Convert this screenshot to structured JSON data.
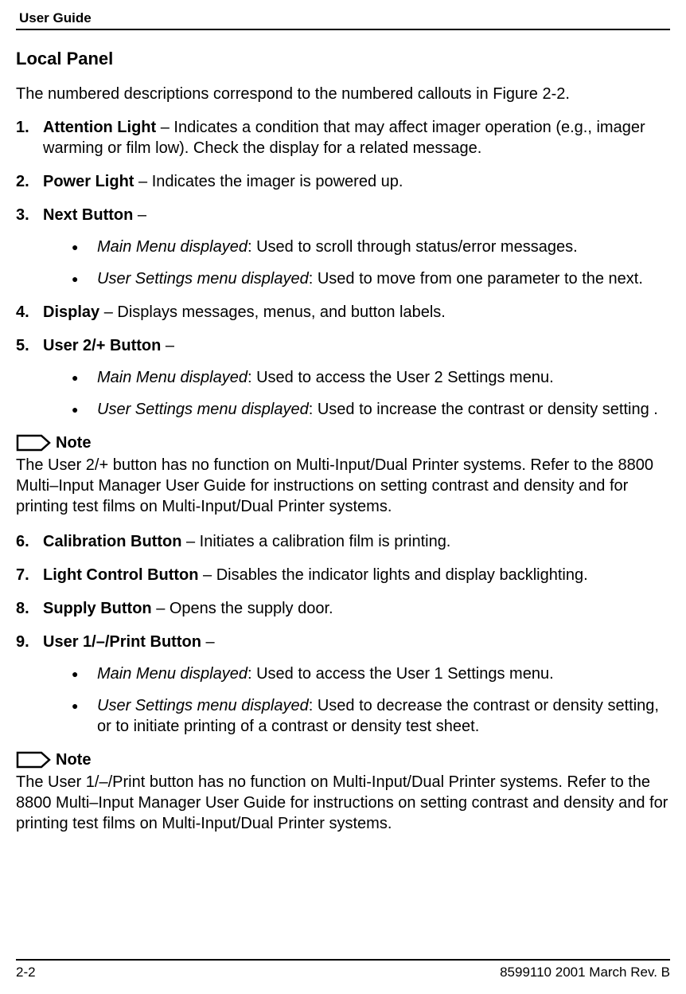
{
  "header": {
    "label": "User Guide"
  },
  "section": {
    "title": "Local Panel",
    "intro": "The numbered descriptions correspond to the numbered callouts in Figure 2-2."
  },
  "items": {
    "i1": {
      "num": "1.",
      "term": "Attention Light",
      "desc": " – Indicates a condition that may affect imager operation (e.g., imager warming or film low). Check the display for a related message."
    },
    "i2": {
      "num": "2.",
      "term": "Power Light",
      "desc": " – Indicates the imager is powered up."
    },
    "i3": {
      "num": "3.",
      "term": "Next Button",
      "desc": " –",
      "sub": {
        "a": {
          "em": "Main Menu displayed",
          "rest": ": Used to scroll through status/error messages."
        },
        "b": {
          "em": "User Settings menu displayed",
          "rest": ": Used to move from one parameter to the next."
        }
      }
    },
    "i4": {
      "num": "4.",
      "term": "Display",
      "desc": " – Displays messages, menus, and button labels."
    },
    "i5": {
      "num": "5.",
      "term": "User 2/+ Button",
      "desc": " –",
      "sub": {
        "a": {
          "em": "Main Menu displayed",
          "rest": ": Used to access the User 2 Settings menu."
        },
        "b": {
          "em": "User Settings menu displayed",
          "rest": ": Used to increase the contrast or density setting ."
        }
      }
    },
    "i6": {
      "num": "6.",
      "term": "Calibration Button",
      "desc": " – Initiates a calibration film is printing."
    },
    "i7": {
      "num": "7.",
      "term": "Light Control Button",
      "desc": " – Disables the indicator lights and display backlighting."
    },
    "i8": {
      "num": "8.",
      "term": "Supply Button",
      "desc": " – Opens the supply door."
    },
    "i9": {
      "num": "9.",
      "term": "User 1/–/Print Button",
      "desc": " –",
      "sub": {
        "a": {
          "em": "Main Menu displayed",
          "rest": ": Used to access the User 1 Settings menu."
        },
        "b": {
          "em": "User Settings menu displayed",
          "rest": ": Used to decrease the contrast or density setting, or to initiate printing of a contrast or density test sheet."
        }
      }
    }
  },
  "notes": {
    "label": "Note",
    "n1": "The User 2/+ button has no function on Multi-Input/Dual Printer systems. Refer to the 8800 Multi–Input Manager User Guide for instructions on setting contrast and density and for printing test films on Multi-Input/Dual Printer systems.",
    "n2": "The User 1/–/Print button has no function on Multi-Input/Dual Printer systems. Refer to the 8800 Multi–Input Manager User Guide for instructions on setting contrast and density and for printing test films on Multi-Input/Dual Printer systems."
  },
  "footer": {
    "page": "2-2",
    "docinfo": "8599110    2001 March Rev. B"
  }
}
